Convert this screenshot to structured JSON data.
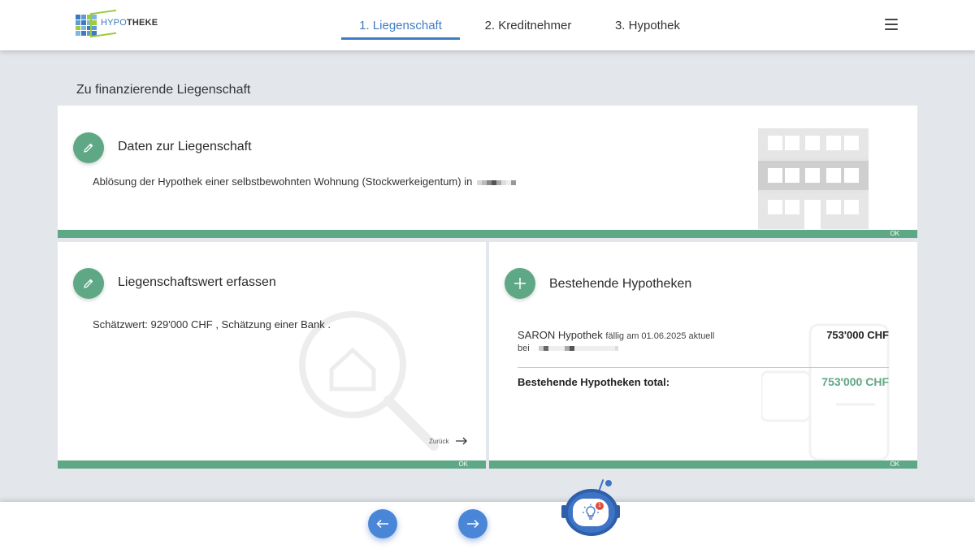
{
  "header": {
    "logo_text_light": "HYPO",
    "logo_text_bold": "THEKE",
    "tabs": [
      {
        "label": "1. Liegenschaft",
        "active": true
      },
      {
        "label": "2. Kreditnehmer",
        "active": false
      },
      {
        "label": "3. Hypothek",
        "active": false
      }
    ],
    "menu_icon": "hamburger-menu-icon"
  },
  "section": {
    "title": "Zu finanzierende Liegenschaft"
  },
  "card_property": {
    "title": "Daten zur Liegenschaft",
    "text": "Ablösung der Hypothek einer selbstbewohnten Wohnung (Stockwerkeigentum) in",
    "status": "OK",
    "icon": "pencil-icon"
  },
  "card_value": {
    "title": "Liegenschaftswert erfassen",
    "text": "Schätzwert: 929'000 CHF , Schätzung einer Bank .",
    "back_label": "Zurück",
    "status": "OK",
    "icon": "pencil-icon"
  },
  "card_mortgages": {
    "title": "Bestehende Hypotheken",
    "icon": "plus-icon",
    "items": [
      {
        "name": "SARON Hypothek",
        "detail": "fällig am 01.06.2025 aktuell",
        "bei": "bei",
        "amount": "753'000 CHF"
      }
    ],
    "total_label": "Bestehende Hypotheken total:",
    "total_amount": "753'000 CHF",
    "status": "OK"
  },
  "footer": {
    "prev_icon": "arrow-left-icon",
    "next_icon": "arrow-right-icon",
    "assistant_badge": "1"
  },
  "colors": {
    "accent_green": "#5fa886",
    "accent_blue": "#3e7cc7",
    "background": "#e3e7eb"
  }
}
